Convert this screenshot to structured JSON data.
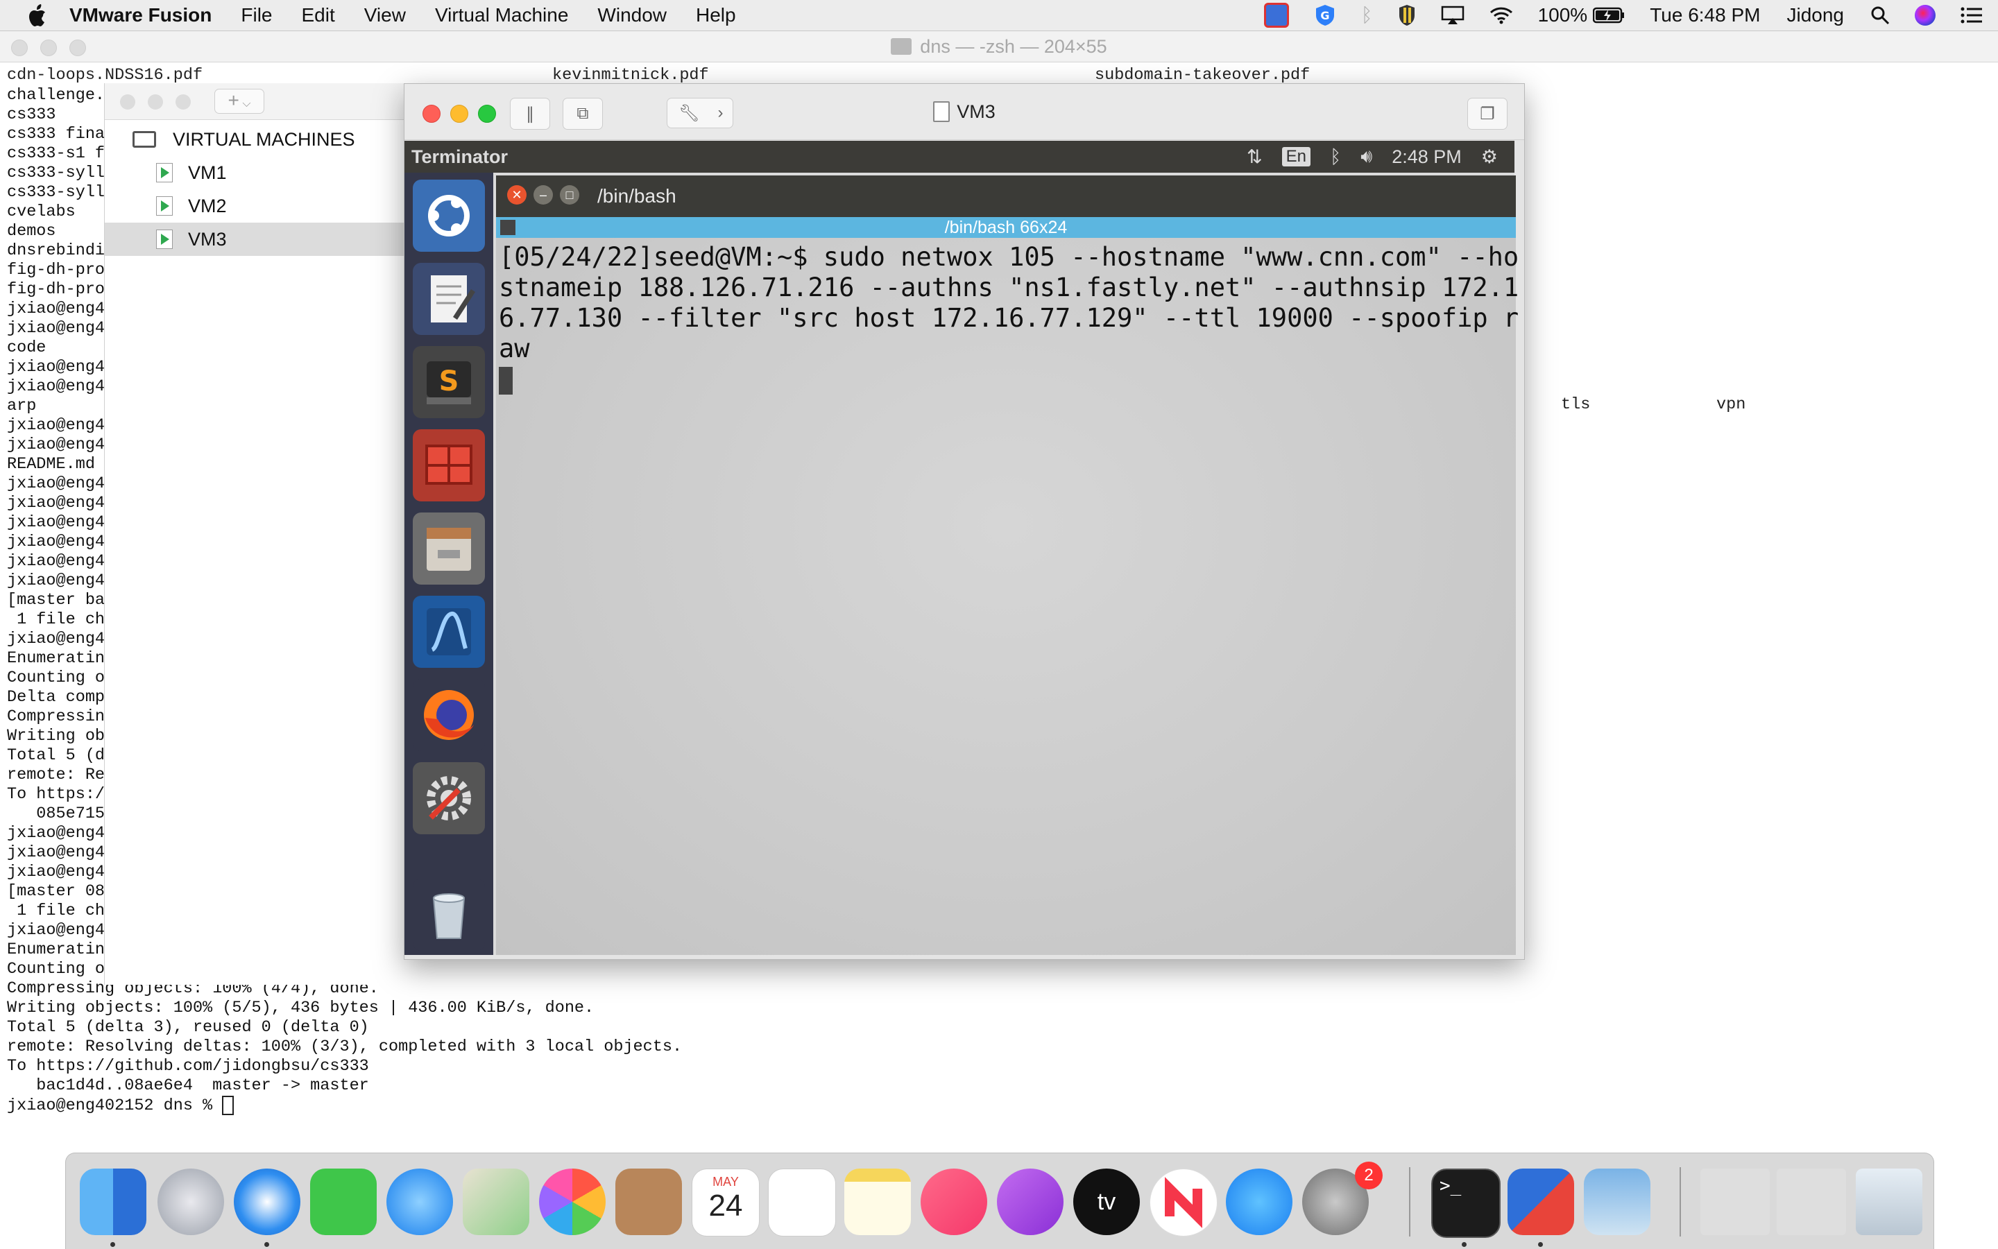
{
  "menubar": {
    "app_name": "VMware Fusion",
    "items": [
      "File",
      "Edit",
      "View",
      "Virtual Machine",
      "Window",
      "Help"
    ],
    "battery": "100%",
    "clock": "Tue 6:48 PM",
    "user": "Jidong"
  },
  "bg_terminal": {
    "title": "dns — -zsh — 204×55",
    "top_files": [
      "cdn-loops.NDSS16.pdf",
      "kevinmitnick.pdf",
      "subdomain-takeover.pdf"
    ],
    "lines": [
      "challenge.",
      "cs333",
      "cs333 fina",
      "cs333-s1 f",
      "cs333-syll",
      "cs333-syll",
      "cvelabs",
      "demos",
      "dnsrebindi",
      "fig-dh-pro",
      "fig-dh-pro",
      "jxiao@eng4",
      "jxiao@eng4",
      "code",
      "jxiao@eng4",
      "jxiao@eng4",
      "arp",
      "jxiao@eng4",
      "jxiao@eng4",
      "README.md",
      "jxiao@eng4",
      "jxiao@eng4",
      "jxiao@eng4",
      "jxiao@eng4",
      "jxiao@eng4",
      "jxiao@eng4",
      "[master ba",
      " 1 file ch",
      "jxiao@eng4",
      "Enumeratin",
      "Counting o",
      "Delta comp",
      "Compressin",
      "Writing ob",
      "Total 5 (d",
      "remote: Re",
      "To https:/",
      "   085e715",
      "jxiao@eng4",
      "jxiao@eng4",
      "jxiao@eng4",
      "[master 08",
      " 1 file ch",
      "jxiao@eng4",
      "Enumeratin",
      "Counting o",
      "Compressing objects: 100% (4/4), done.",
      "Writing objects: 100% (5/5), 436 bytes | 436.00 KiB/s, done.",
      "Total 5 (delta 3), reused 0 (delta 0)",
      "remote: Resolving deltas: 100% (3/3), completed with 3 local objects.",
      "To https://github.com/jidongbsu/cs333",
      "   bac1d4d..08ae6e4  master -> master"
    ],
    "prompt": "jxiao@eng402152 dns % ",
    "col_tls": "tls",
    "col_vpn": "vpn"
  },
  "library": {
    "add_label": "+",
    "section": "VIRTUAL MACHINES",
    "vms": [
      "VM1",
      "VM2",
      "VM3"
    ],
    "selected": "VM3"
  },
  "vm_window": {
    "title": "VM3"
  },
  "guest": {
    "app_title": "Terminator",
    "lang": "En",
    "clock": "2:48 PM",
    "term_title": "/bin/bash",
    "tab_title": "/bin/bash 66x24",
    "term_lines": [
      "[05/24/22]seed@VM:~$ sudo netwox 105 --hostname \"www.cnn.com\" --ho",
      "stnameip 188.126.71.216 --authns \"ns1.fastly.net\" --authnsip 172.1",
      "6.77.130 --filter \"src host 172.16.77.129\" --ttl 19000 --spoofip r",
      "aw"
    ]
  },
  "dock": {
    "calendar_month": "MAY",
    "calendar_day": "24",
    "appstore_badge": "2",
    "tv_label": "tv"
  }
}
